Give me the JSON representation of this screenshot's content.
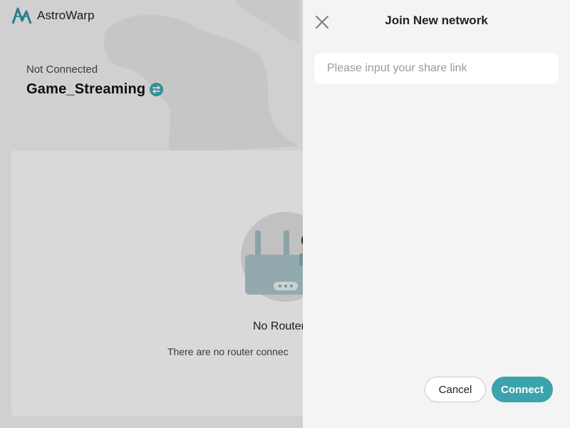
{
  "app": {
    "name": "AstroWarp",
    "logo_icon": "astrowarp-logo-icon",
    "status": "Not Connected",
    "network_name": "Game_Streaming",
    "switch_icon": "swap-arrows-icon",
    "accent_color": "#3ba3ad",
    "empty_state": {
      "illustration": "router-illustration",
      "title": "No Router",
      "subtitle": "There are no router connec"
    }
  },
  "drawer": {
    "title": "Join New network",
    "close_icon": "close-icon",
    "share_input": {
      "placeholder": "Please input your share link",
      "value": ""
    },
    "cancel_label": "Cancel",
    "connect_label": "Connect"
  }
}
